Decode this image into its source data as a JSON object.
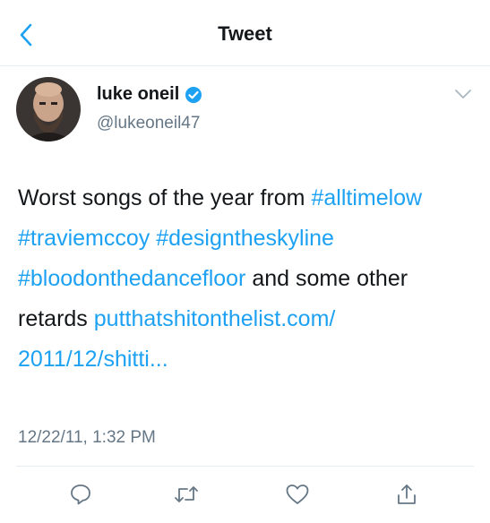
{
  "header": {
    "title": "Tweet",
    "back_icon": "chevron-left-icon"
  },
  "tweet": {
    "author": {
      "name": "luke oneil",
      "handle": "@lukeoneil47",
      "verified": true
    },
    "text_parts": [
      {
        "text": "Worst songs of the year from ",
        "type": "text"
      },
      {
        "text": "#alltimelow",
        "type": "hashtag"
      },
      {
        "text": " ",
        "type": "text"
      },
      {
        "text": "#traviemccoy",
        "type": "hashtag"
      },
      {
        "text": " ",
        "type": "text"
      },
      {
        "text": "#designtheskyline",
        "type": "hashtag"
      },
      {
        "text": " ",
        "type": "text"
      },
      {
        "text": "#bloodonthedancefloor",
        "type": "hashtag"
      },
      {
        "text": " and some other retards ",
        "type": "text"
      },
      {
        "text": "putthatshitonthelist.com/ 2011/12/shitti...",
        "type": "link"
      }
    ],
    "timestamp": "12/22/11, 1:32 PM"
  },
  "actions": {
    "reply_icon": "reply-icon",
    "retweet_icon": "retweet-icon",
    "like_icon": "heart-icon",
    "share_icon": "share-icon"
  },
  "colors": {
    "link": "#1da1f2",
    "text": "#14171a",
    "muted": "#657786",
    "divider": "#e6ecf0"
  }
}
